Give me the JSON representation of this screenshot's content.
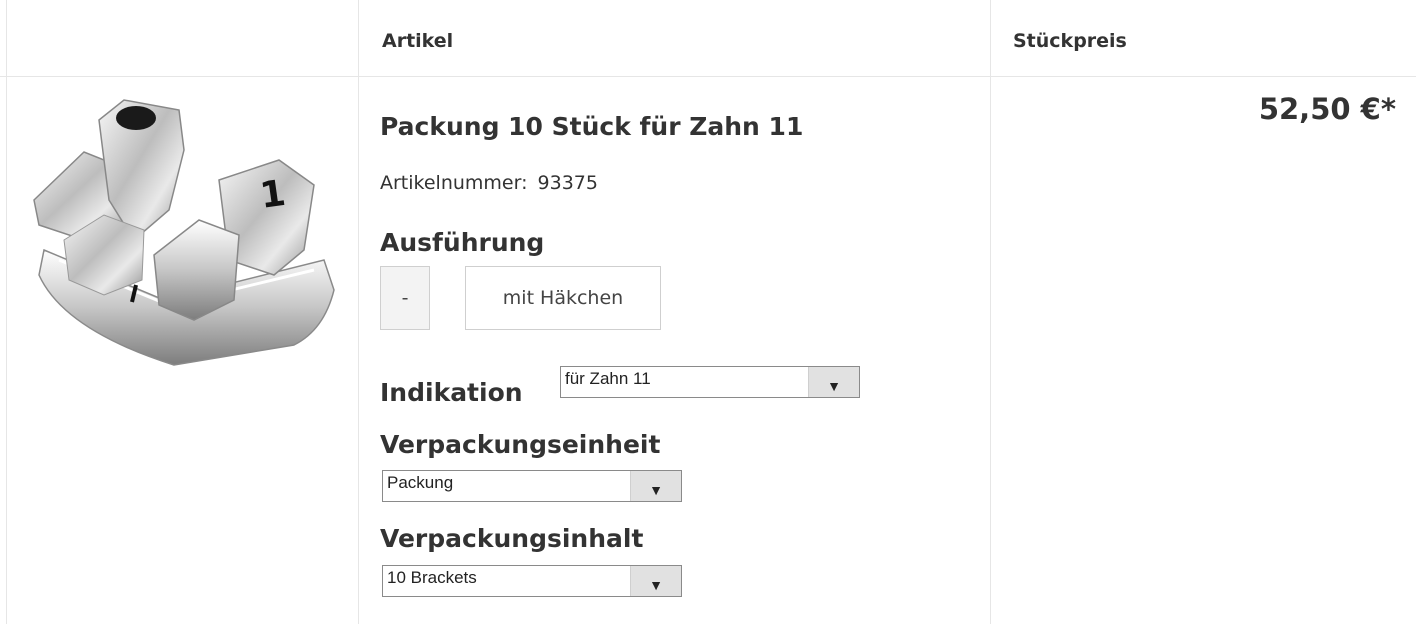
{
  "table": {
    "headers": {
      "article": "Artikel",
      "unit_price": "Stückpreis"
    }
  },
  "product": {
    "title": "Packung 10 Stück für Zahn 11",
    "article_number_label": "Artikelnummer:",
    "article_number": "93375",
    "price": "52,50 €*",
    "image_label": "1"
  },
  "options": {
    "ausfuehrung": {
      "label": "Ausführung",
      "choices": [
        "-",
        "mit Häkchen"
      ]
    },
    "indikation": {
      "label": "Indikation",
      "selected": "für Zahn 11"
    },
    "verpackungseinheit": {
      "label": "Verpackungseinheit",
      "selected": "Packung"
    },
    "verpackungsinhalt": {
      "label": "Verpackungsinhalt",
      "selected": "10 Brackets"
    }
  }
}
